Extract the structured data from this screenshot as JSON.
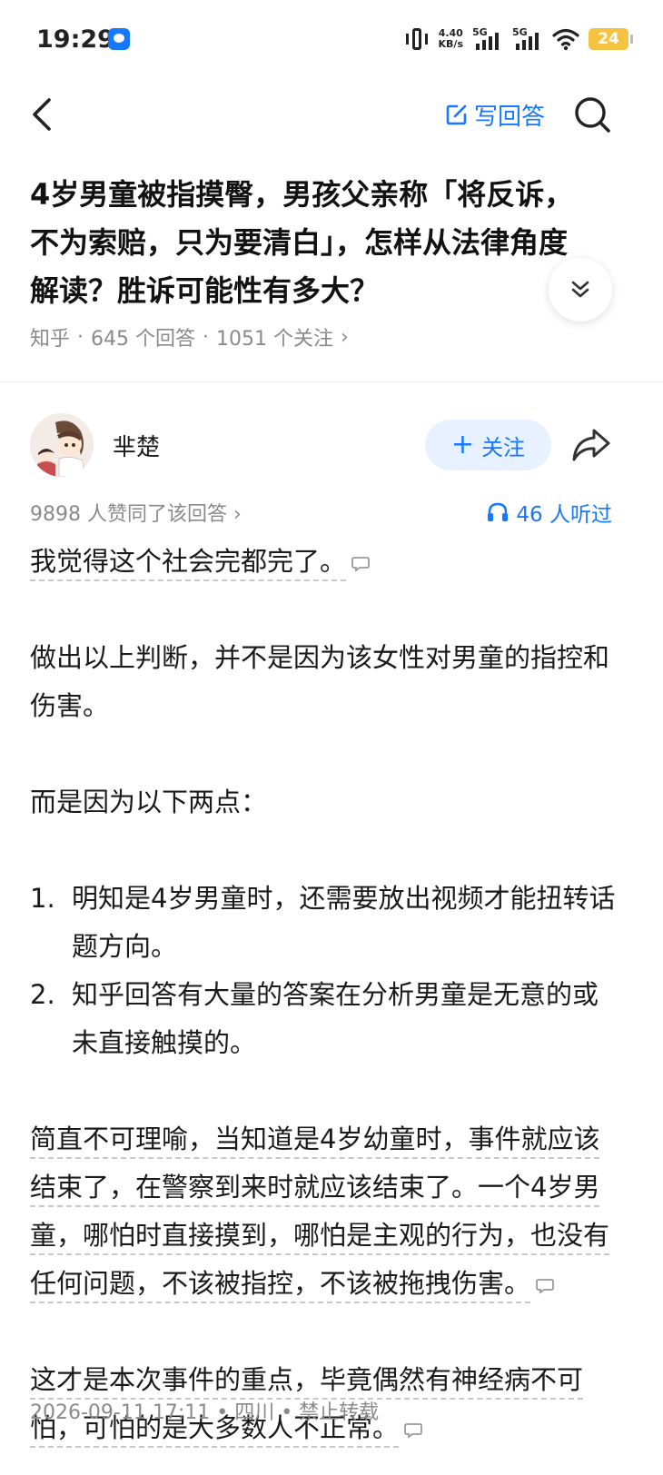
{
  "status_bar": {
    "time": "19:29",
    "net_speed_value": "4.40",
    "net_speed_unit": "KB/s",
    "signal1_label": "5G",
    "signal2_label": "5G",
    "battery": "24"
  },
  "header": {
    "write_answer": "写回答"
  },
  "question": {
    "title": "4岁男童被指摸臀，男孩父亲称「将反诉，不为索赔，只为要清白」，怎样从法律角度解读？胜诉可能性有多大？",
    "source": "知乎",
    "answer_count": "645 个回答",
    "follower_count": "1051 个关注",
    "separator": "·",
    "chevron": "›"
  },
  "author": {
    "name": "芈楚",
    "follow_label": "关注",
    "follow_plus": "+"
  },
  "stats": {
    "upvotes": "9898 人赞同了该回答",
    "chevron": "›",
    "listens": "46 人听过"
  },
  "answer": {
    "p1": "我觉得这个社会完都完了。",
    "p2": "做出以上判断，并不是因为该女性对男童的指控和伤害。",
    "p3": "而是因为以下两点：",
    "list": [
      {
        "num": "1.",
        "text": "明知是4岁男童时，还需要放出视频才能扭转话题方向。"
      },
      {
        "num": "2.",
        "text": "知乎回答有大量的答案在分析男童是无意的或未直接触摸的。"
      }
    ],
    "p4": "简直不可理喻，当知道是4岁幼童时，事件就应该结束了，在警察到来时就应该结束了。一个4岁男童，哪怕时直接摸到，哪怕是主观的行为，也没有任何问题，不该被指控，不该被拖拽伤害。",
    "p5": "这才是本次事件的重点，毕竟偶然有神经病不可怕，可怕的是大多数人不正常。"
  },
  "footer": {
    "meta": "2026-09-11 17:11 • 四川 • 禁止转载"
  },
  "colors": {
    "accent": "#1677ff",
    "follow_bg": "#e8f1ff",
    "meta_gray": "#8a8a8a",
    "battery": "#f5c342"
  },
  "icons": [
    "back-arrow-icon",
    "edit-icon",
    "search-icon",
    "expand-chevron-icon",
    "share-icon",
    "headphones-icon",
    "comment-icon",
    "wifi-icon",
    "vibrate-icon"
  ]
}
